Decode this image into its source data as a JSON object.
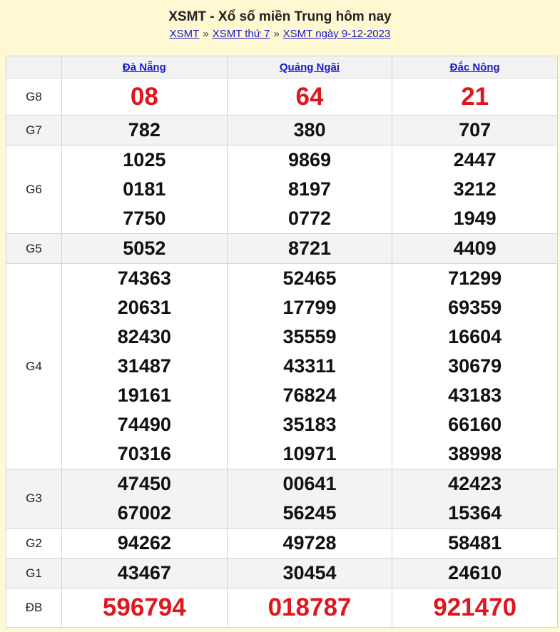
{
  "header": {
    "title": "XSMT - Xổ số miền Trung hôm nay",
    "breadcrumb": [
      "XSMT",
      "XSMT thứ 7",
      "XSMT ngày 9-12-2023"
    ],
    "separator": "»"
  },
  "provinces": [
    "Đà Nẵng",
    "Quảng Ngãi",
    "Đắc Nông"
  ],
  "prizes": [
    {
      "label": "G8",
      "results": [
        [
          "08"
        ],
        [
          "64"
        ],
        [
          "21"
        ]
      ]
    },
    {
      "label": "G7",
      "results": [
        [
          "782"
        ],
        [
          "380"
        ],
        [
          "707"
        ]
      ]
    },
    {
      "label": "G6",
      "results": [
        [
          "1025",
          "0181",
          "7750"
        ],
        [
          "9869",
          "8197",
          "0772"
        ],
        [
          "2447",
          "3212",
          "1949"
        ]
      ]
    },
    {
      "label": "G5",
      "results": [
        [
          "5052"
        ],
        [
          "8721"
        ],
        [
          "4409"
        ]
      ]
    },
    {
      "label": "G4",
      "results": [
        [
          "74363",
          "20631",
          "82430",
          "31487",
          "19161",
          "74490",
          "70316"
        ],
        [
          "52465",
          "17799",
          "35559",
          "43311",
          "76824",
          "35183",
          "10971"
        ],
        [
          "71299",
          "69359",
          "16604",
          "30679",
          "43183",
          "66160",
          "38998"
        ]
      ]
    },
    {
      "label": "G3",
      "results": [
        [
          "47450",
          "67002"
        ],
        [
          "00641",
          "56245"
        ],
        [
          "42423",
          "15364"
        ]
      ]
    },
    {
      "label": "G2",
      "results": [
        [
          "94262"
        ],
        [
          "49728"
        ],
        [
          "58481"
        ]
      ]
    },
    {
      "label": "G1",
      "results": [
        [
          "43467"
        ],
        [
          "30454"
        ],
        [
          "24610"
        ]
      ]
    },
    {
      "label": "ĐB",
      "results": [
        [
          "596794"
        ],
        [
          "018787"
        ],
        [
          "921470"
        ]
      ]
    }
  ],
  "colors": {
    "highlight": "#e0161f",
    "link": "#1a1ac8",
    "header_bg": "#fff8d2"
  }
}
